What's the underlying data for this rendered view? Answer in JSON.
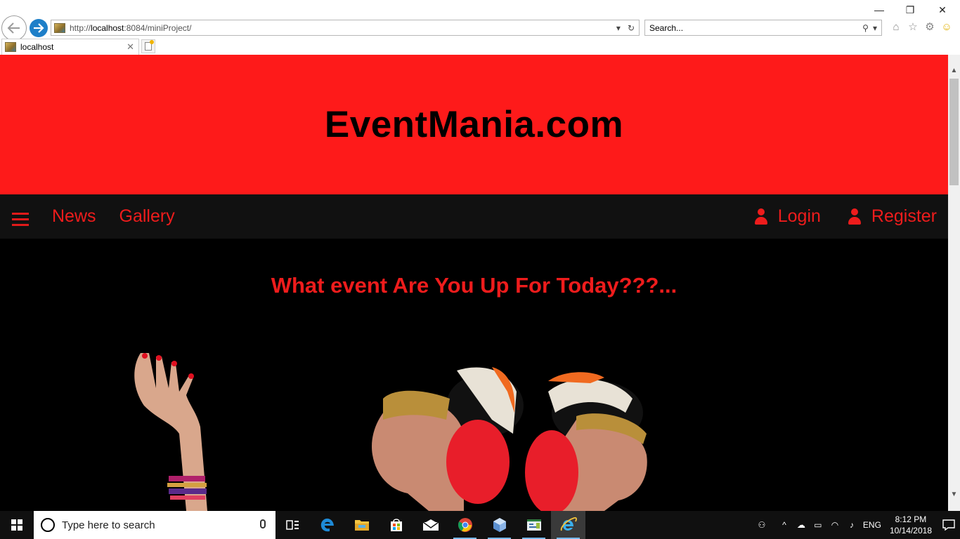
{
  "browser": {
    "address": {
      "prefix": "http://",
      "host": "localhost",
      "rest": ":8084/miniProject/"
    },
    "search_placeholder": "Search...",
    "tab_title": "localhost",
    "window_controls": {
      "minimize": "—",
      "restore": "❐",
      "close": "✕"
    }
  },
  "page": {
    "site_title": "EventMania.com",
    "nav_left": [
      "News",
      "Gallery"
    ],
    "nav_right": [
      "Login",
      "Register"
    ],
    "tagline": "What event Are You Up For Today???...",
    "colors": {
      "banner": "#fe1a1a",
      "accent": "#ee1c1c",
      "nav_bg": "#111111",
      "page_bg": "#000000"
    }
  },
  "taskbar": {
    "search_placeholder": "Type here to search",
    "language": "ENG",
    "time": "8:12 PM",
    "date": "10/14/2018",
    "apps": [
      "task-view-icon",
      "edge-icon",
      "file-explorer-icon",
      "store-icon",
      "mail-icon",
      "chrome-icon",
      "virtualbox-icon",
      "netbeans-icon",
      "internet-explorer-icon"
    ]
  }
}
